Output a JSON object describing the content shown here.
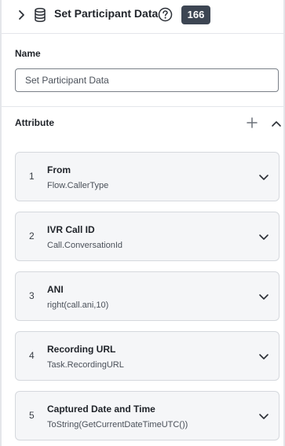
{
  "header": {
    "title": "Set Participant Data",
    "badge": "166",
    "icons": {
      "expand": "chevron-right-icon",
      "type": "database-icon",
      "help": "help-circle-icon"
    }
  },
  "name_section": {
    "label": "Name",
    "value": "Set Participant Data"
  },
  "attribute_section": {
    "title": "Attribute",
    "icons": {
      "add": "plus-icon",
      "collapse": "chevron-up-icon"
    },
    "items": [
      {
        "index": "1",
        "name": "From",
        "value": "Flow.CallerType"
      },
      {
        "index": "2",
        "name": "IVR Call ID",
        "value": "Call.ConversationId"
      },
      {
        "index": "3",
        "name": "ANI",
        "value": "right(call.ani,10)"
      },
      {
        "index": "4",
        "name": "Recording URL",
        "value": "Task.RecordingURL"
      },
      {
        "index": "5",
        "name": "Captured Date and Time",
        "value": "ToString(GetCurrentDateTimeUTC())"
      }
    ]
  },
  "colors": {
    "badge_background": "#3d4653",
    "card_background": "#f5f6f8",
    "card_border": "#d5d8dd",
    "text_primary": "#1f2329"
  }
}
